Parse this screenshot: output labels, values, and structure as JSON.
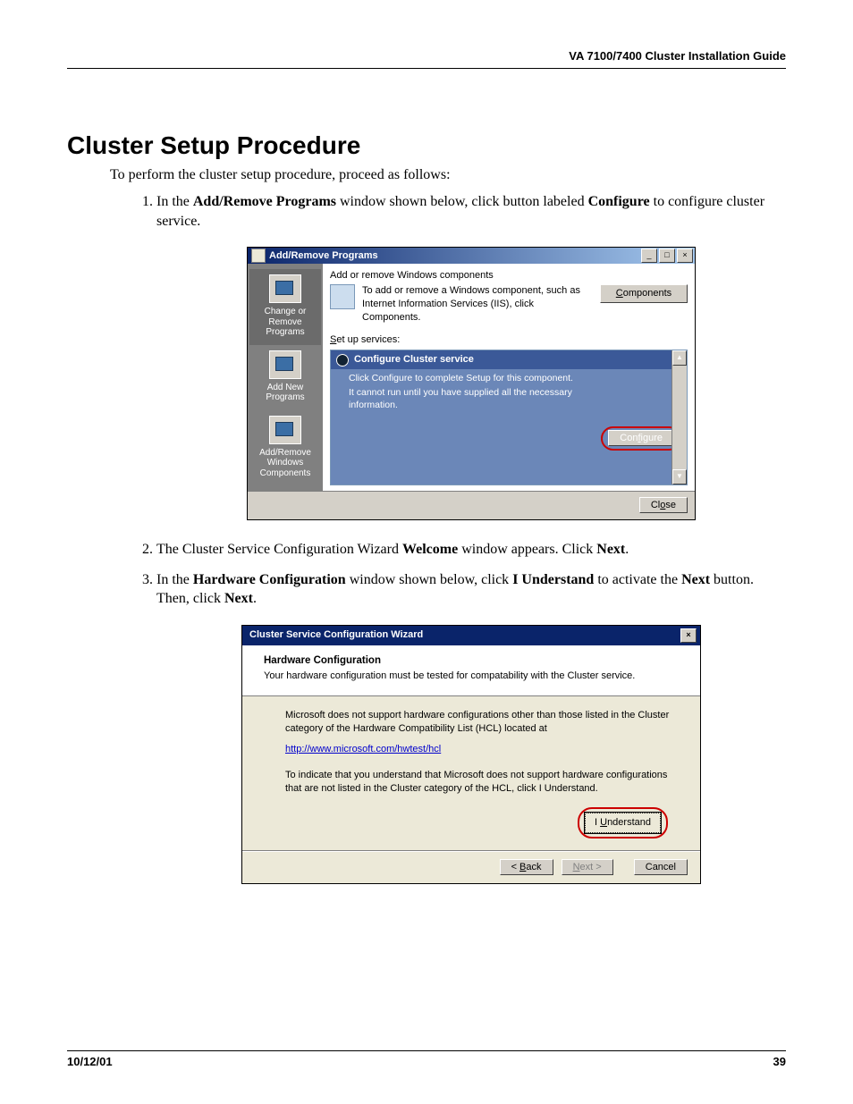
{
  "page": {
    "header_right": "VA 7100/7400 Cluster Installation Guide",
    "footer_date": "10/12/01",
    "footer_page": "39"
  },
  "doc": {
    "title": "Cluster Setup Procedure",
    "intro": "To perform the cluster setup procedure, proceed as follows:",
    "step1_pre": "In the ",
    "step1_bold1": "Add/Remove Programs",
    "step1_mid": " window shown below, click button labeled ",
    "step1_bold2": "Configure",
    "step1_post": " to configure cluster service.",
    "step2_pre": "The Cluster Service Configuration Wizard ",
    "step2_bold1": "Welcome",
    "step2_mid": " window appears.  Click ",
    "step2_bold2": "Next",
    "step2_post": ".",
    "step3_pre": "In the ",
    "step3_bold1": "Hardware Configuration",
    "step3_mid": " window shown below, click ",
    "step3_bold2": "I Understand",
    "step3_mid2": " to activate the ",
    "step3_bold3": "Next",
    "step3_post": " button.  Then, click ",
    "step3_bold4": "Next",
    "step3_post2": "."
  },
  "arp": {
    "title": "Add/Remove Programs",
    "sidebar": {
      "change": "Change or Remove Programs",
      "addnew": "Add New Programs",
      "addrem": "Add/Remove Windows Components"
    },
    "heading": "Add or remove Windows components",
    "desc": "To add or remove a Windows component, such as Internet Information Services (IIS), click Components.",
    "components_btn": "Components",
    "setup_label": "Set up services:",
    "svc_title": "Configure Cluster service",
    "svc_line1": "Click Configure to complete Setup for this component.",
    "svc_line2": "It cannot run until you have supplied all the necessary information.",
    "configure_btn": "Configure",
    "close_btn": "Close"
  },
  "wiz": {
    "title": "Cluster Service Configuration Wizard",
    "head1": "Hardware Configuration",
    "head2": "Your hardware configuration must be tested for compatability with the Cluster service.",
    "para1": "Microsoft does not support hardware configurations other than those listed in the Cluster category of the Hardware Compatibility List (HCL) located at",
    "link": "http://www.microsoft.com/hwtest/hcl",
    "para2": "To indicate that you understand that Microsoft does not support hardware configurations that are not listed in the Cluster category of the HCL, click I Understand.",
    "iu_btn": "I Understand",
    "back_btn": "< Back",
    "next_btn": "Next >",
    "cancel_btn": "Cancel"
  }
}
